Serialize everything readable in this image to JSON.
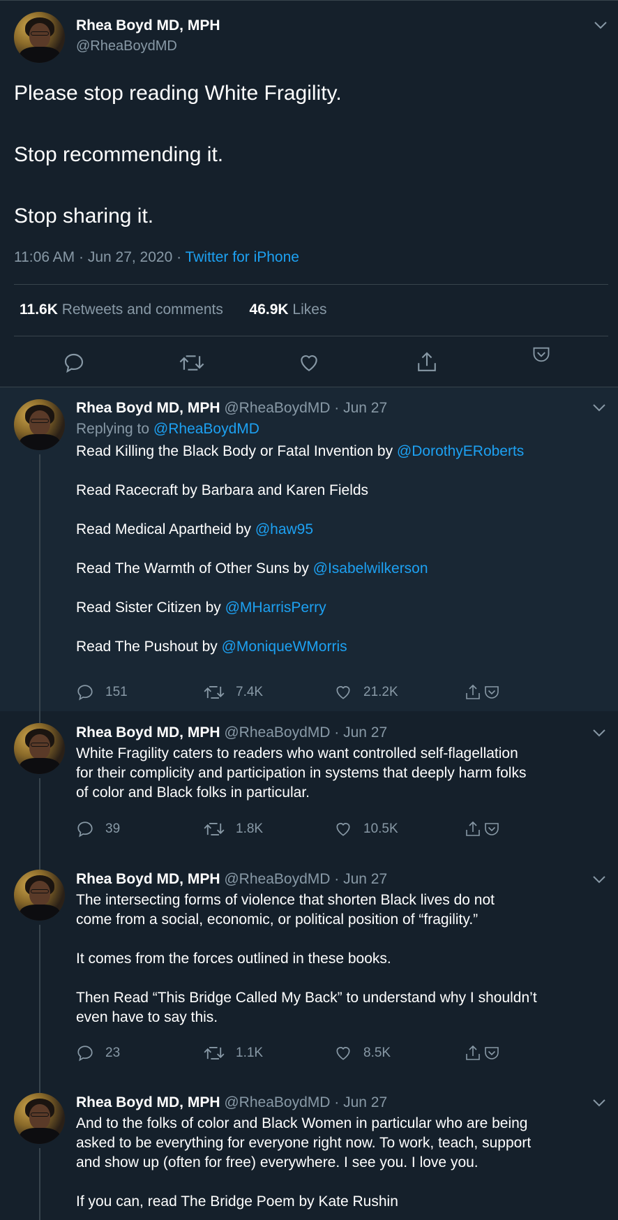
{
  "main_tweet": {
    "display_name": "Rhea Boyd MD, MPH",
    "handle": "@RheaBoydMD",
    "lines": [
      "Please stop reading White Fragility.",
      "Stop recommending it.",
      "Stop sharing it."
    ],
    "time": "11:06 AM · Jun 27, 2020 · ",
    "source": "Twitter for iPhone",
    "retweets_count": "11.6K",
    "retweets_label": "Retweets and comments",
    "likes_count": "46.9K",
    "likes_label": "Likes"
  },
  "replies": [
    {
      "display_name": "Rhea Boyd MD, MPH",
      "handle_date": "@RheaBoydMD · Jun 27",
      "replying_prefix": "Replying to ",
      "replying_to": "@RheaBoydMD",
      "books": [
        {
          "text": "Read Killing the Black Body or Fatal Invention by ",
          "mention": "@DorothyERoberts"
        },
        {
          "text": "Read Racecraft by Barbara and Karen Fields",
          "mention": ""
        },
        {
          "text": "Read Medical Apartheid by ",
          "mention": "@haw95"
        },
        {
          "text": "Read The Warmth of Other Suns by ",
          "mention": "@Isabelwilkerson"
        },
        {
          "text": "Read Sister Citizen by ",
          "mention": "@MHarrisPerry"
        },
        {
          "text": "Read The Pushout by ",
          "mention": "@MoniqueWMorris"
        }
      ],
      "comments": "151",
      "retweets": "7.4K",
      "likes": "21.2K"
    },
    {
      "display_name": "Rhea Boyd MD, MPH",
      "handle_date": "@RheaBoydMD · Jun 27",
      "lines": [
        "White Fragility caters to readers who want controlled self-flagellation",
        "for their complicity and participation in systems that deeply harm folks",
        "of color and Black folks in particular."
      ],
      "comments": "39",
      "retweets": "1.8K",
      "likes": "10.5K"
    },
    {
      "display_name": "Rhea Boyd MD, MPH",
      "handle_date": "@RheaBoydMD · Jun 27",
      "para1": [
        "The intersecting forms of violence that shorten Black lives do not",
        "come from a social, economic, or political position of “fragility.”"
      ],
      "para2": "It comes from the forces outlined in these books.",
      "para3": [
        "Then Read “This Bridge Called My Back” to understand why I shouldn’t",
        "even have to say this."
      ],
      "comments": "23",
      "retweets": "1.1K",
      "likes": "8.5K"
    },
    {
      "display_name": "Rhea Boyd MD, MPH",
      "handle_date": "@RheaBoydMD · Jun 27",
      "lines": [
        "And to the folks of color and Black Women in particular who are being",
        "asked to be everything for everyone right now. To work, teach, support",
        "and show up (often for free) everywhere. I see you. I love you."
      ],
      "last_line": "If you can, read The Bridge Poem by Kate Rushin"
    }
  ]
}
